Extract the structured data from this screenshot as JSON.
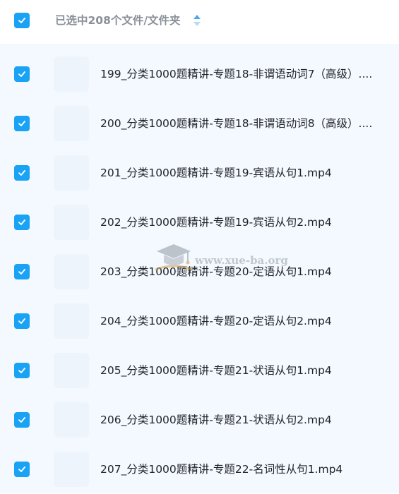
{
  "header": {
    "select_all_checked": true,
    "title": "已选中208个文件/文件夹",
    "sort_icon": "sort-icon"
  },
  "files": [
    {
      "name": "199_分类1000题精讲-专题18-非谓语动词7（高级）....",
      "checked": true
    },
    {
      "name": "200_分类1000题精讲-专题18-非谓语动词8（高级）....",
      "checked": true
    },
    {
      "name": "201_分类1000题精讲-专题19-宾语从句1.mp4",
      "checked": true
    },
    {
      "name": "202_分类1000题精讲-专题19-宾语从句2.mp4",
      "checked": true
    },
    {
      "name": "203_分类1000题精讲-专题20-定语从句1.mp4",
      "checked": true
    },
    {
      "name": "204_分类1000题精讲-专题20-定语从句2.mp4",
      "checked": true
    },
    {
      "name": "205_分类1000题精讲-专题21-状语从句1.mp4",
      "checked": true
    },
    {
      "name": "206_分类1000题精讲-专题21-状语从句2.mp4",
      "checked": true
    },
    {
      "name": "207_分类1000题精讲-专题22-名词性从句1.mp4",
      "checked": true
    }
  ],
  "watermark": {
    "text": "www.xue-ba.org",
    "icon": "graduation-cap-icon"
  },
  "colors": {
    "checkbox": "#1aa3f5",
    "list_background": "#f4f9ff",
    "header_text": "#8a9099",
    "file_text": "#1f2329"
  }
}
